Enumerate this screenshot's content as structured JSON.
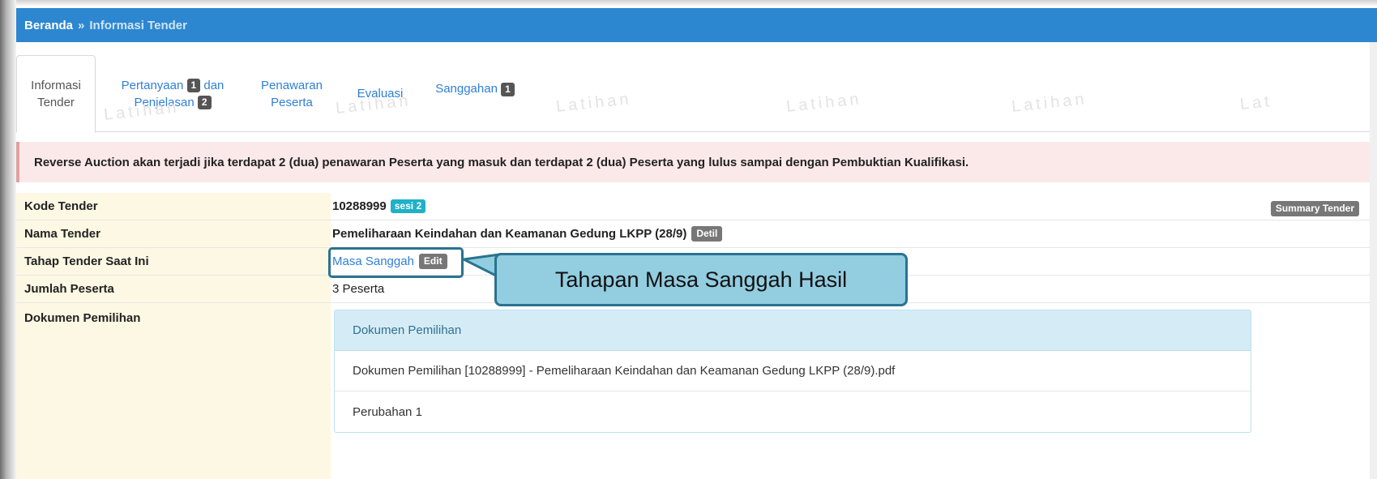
{
  "breadcrumb": {
    "home": "Beranda",
    "separator": "»",
    "current": "Informasi Tender"
  },
  "tabs": {
    "informasi_line1": "Informasi",
    "informasi_line2": "Tender",
    "pertanyaan_line1": "Pertanyaan",
    "pertanyaan_badge": "1",
    "pertanyaan_dan": "dan",
    "penjelasan": "Penjelasan",
    "penjelasan_badge": "2",
    "penawaran_line1": "Penawaran",
    "penawaran_line2": "Peserta",
    "evaluasi": "Evaluasi",
    "sanggahan": "Sanggahan",
    "sanggahan_badge": "1"
  },
  "watermark": {
    "text": "Latihan",
    "partial": "Lat"
  },
  "alert": {
    "text": "Reverse Auction akan terjadi jika terdapat 2 (dua) penawaran Peserta yang masuk dan terdapat 2 (dua) Peserta yang lulus sampai dengan Pembuktian Kualifikasi."
  },
  "info": {
    "kode_label": "Kode Tender",
    "kode_value": "10288999",
    "sesi_badge": "sesi 2",
    "summary_button": "Summary Tender",
    "nama_label": "Nama Tender",
    "nama_value": "Pemeliharaan Keindahan dan Keamanan Gedung LKPP (28/9)",
    "detil_badge": "Detil",
    "tahap_label": "Tahap Tender Saat Ini",
    "tahap_value": "Masa Sanggah",
    "edit_badge": "Edit",
    "jumlah_label": "Jumlah Peserta",
    "jumlah_value": "3 Peserta",
    "dokumen_label": "Dokumen Pemilihan"
  },
  "dokumen_panel": {
    "heading": "Dokumen Pemilihan",
    "items": [
      "Dokumen Pemilihan [10288999] - Pemeliharaan Keindahan dan Keamanan Gedung LKPP (28/9).pdf",
      "Perubahan 1"
    ]
  },
  "callout": {
    "text": "Tahapan Masa Sanggah Hasil"
  }
}
